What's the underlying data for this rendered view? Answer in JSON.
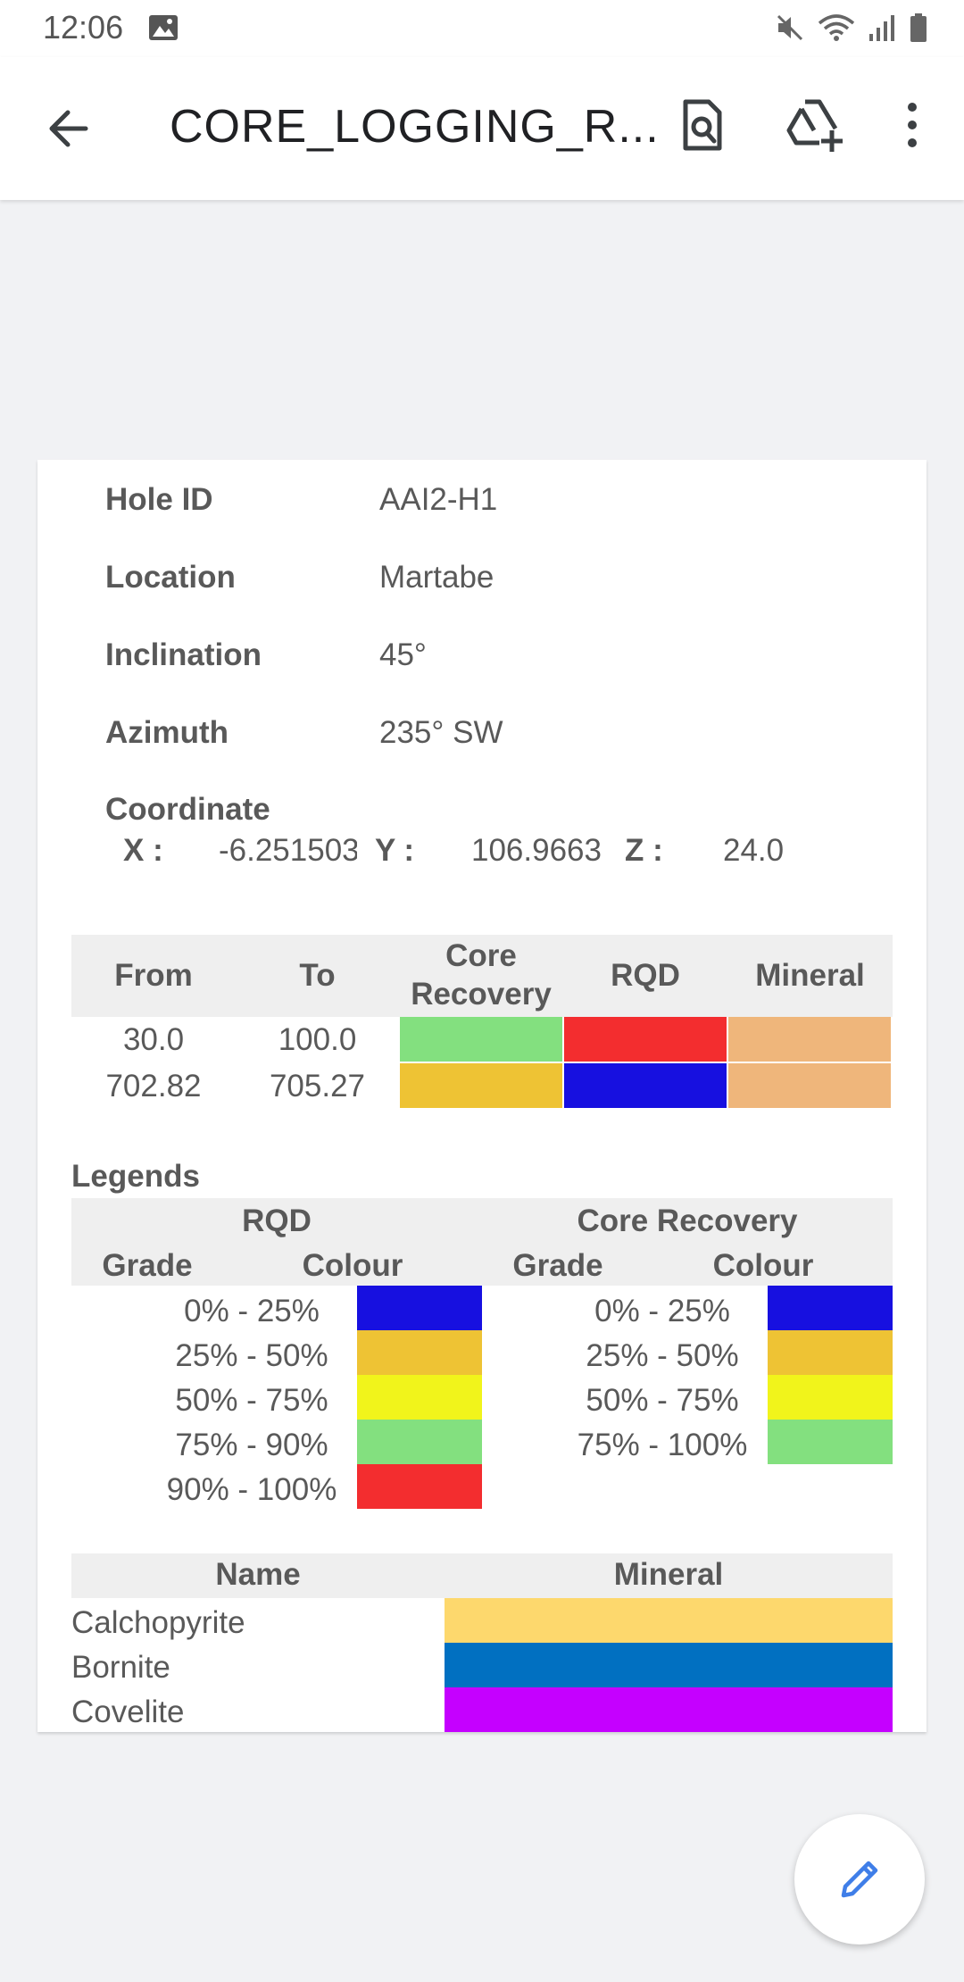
{
  "status_bar": {
    "time": "12:06"
  },
  "app_bar": {
    "title": "CORE_LOGGING_R..."
  },
  "info": {
    "hole_id_label": "Hole ID",
    "hole_id": "AAI2-H1",
    "location_label": "Location",
    "location": "Martabe",
    "inclination_label": "Inclination",
    "inclination": "45°",
    "azimuth_label": "Azimuth",
    "azimuth": "235° SW",
    "coordinate_label": "Coordinate",
    "x_label": "X :",
    "x_value": "-6.251503",
    "y_label": "Y :",
    "y_value": "106.9663",
    "z_label": "Z :",
    "z_value": "24.0"
  },
  "log_table": {
    "headers": {
      "from": "From",
      "to": "To",
      "core_recovery_1": "Core",
      "core_recovery_2": "Recovery",
      "rqd": "RQD",
      "mineral": "Mineral"
    },
    "rows": [
      {
        "from": "30.0",
        "to": "100.0",
        "core_color": "#83e07f",
        "rqd_color": "#f32d2f",
        "mineral_color": "#efb67b"
      },
      {
        "from": "702.82",
        "to": "705.27",
        "core_color": "#eec334",
        "rqd_color": "#1710e0",
        "mineral_color": "#efb67b"
      }
    ]
  },
  "legends": {
    "title": "Legends",
    "rqd_header": "RQD",
    "core_header": "Core Recovery",
    "grade_label": "Grade",
    "colour_label": "Colour",
    "rqd": [
      {
        "grade": "0% - 25%",
        "color": "#1710e0"
      },
      {
        "grade": "25% - 50%",
        "color": "#eec334"
      },
      {
        "grade": "50% - 75%",
        "color": "#f1f41b"
      },
      {
        "grade": "75% - 90%",
        "color": "#83e07f"
      },
      {
        "grade": "90% - 100%",
        "color": "#f32d2f"
      }
    ],
    "core": [
      {
        "grade": "0% - 25%",
        "color": "#1710e0"
      },
      {
        "grade": "25% - 50%",
        "color": "#eec334"
      },
      {
        "grade": "50% - 75%",
        "color": "#f1f41b"
      },
      {
        "grade": "75% - 100%",
        "color": "#83e07f"
      }
    ]
  },
  "minerals": {
    "name_header": "Name",
    "mineral_header": "Mineral",
    "items": [
      {
        "name": "Calchopyrite",
        "color": "#fdd86d"
      },
      {
        "name": "Bornite",
        "color": "#0170c1"
      },
      {
        "name": "Covelite",
        "color": "#c500ff"
      }
    ]
  }
}
